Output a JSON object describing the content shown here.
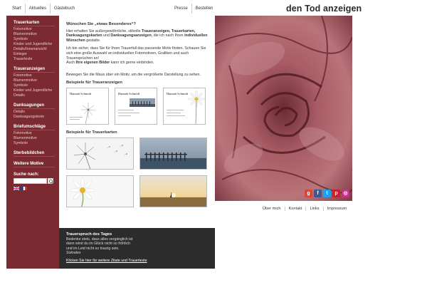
{
  "nav_left": [
    "Start",
    "Aktuelles",
    "Gästebuch"
  ],
  "nav_right": [
    "Presse",
    "Bestellen"
  ],
  "site_title": "den Tod anzeigen",
  "sidebar": {
    "groups": [
      {
        "title": "Trauerkarten",
        "items": [
          "Fotomotive",
          "Blumenmotive",
          "Symbole",
          "Kinder und Jugendliche",
          "Details/Innenansicht",
          "Einleger",
          "Trauertexte"
        ]
      },
      {
        "title": "Traueranzeigen",
        "items": [
          "Fotomotive",
          "Blumenmotive",
          "Symbole",
          "Kinder und Jugendliche",
          "Details"
        ]
      },
      {
        "title": "Danksagungen",
        "items": [
          "Details",
          "Danksagungstexte"
        ]
      },
      {
        "title": "Briefumschläge",
        "items": [
          "Fotomotive",
          "Blumenmotive",
          "Symbole"
        ]
      },
      {
        "title": "Sterbebildchen",
        "items": []
      },
      {
        "title": "Weitere Motive",
        "items": []
      }
    ],
    "search_label": "Suche nach:",
    "search_placeholder": ""
  },
  "main": {
    "heading": "Wünschen Sie „etwas Besonderes“?",
    "p1_a": "Hier erhalten Sie außergewöhnliche, stilvolle ",
    "p1_b": "Traueranzeigen, Trauerkarten, Danksagungskarten",
    "p1_c": " und ",
    "p1_d": "Danksagungsanzeigen",
    "p1_e": ", die ich nach Ihren ",
    "p1_f": "individuellen Wünschen",
    "p1_g": " gestalte.",
    "p2_a": "Ich bin sicher, dass Sie für Ihren Trauerfall das passende Motiv finden. Schauen Sie sich eine große Auswahl an individuellen Fotomotiven, Grafiken und auch Trauersprüchen an!",
    "p2_b": "Auch ",
    "p2_c": "Ihre eigenen Bilder",
    "p2_d": " kann ich gerne einbinden.",
    "hover_hint": "Bewegen Sie die Maus über ein Motiv, um die vergrößerte Darstellung zu sehen.",
    "section1": "Beispiele für Traueranzeigen",
    "section2": "Beispiele für Trauerkarten",
    "sample_name": "Hannah Schmidt"
  },
  "quote": {
    "title": "Trauerspruch des Tages",
    "lines": [
      "Bedenke stets, dass alles vergänglich ist",
      "dann wirst du im Glück nicht so fröhlich",
      "und im Leid nicht so traurig sein."
    ],
    "author": "Sokrates",
    "link": "Klicken Sie hier für weitere Zitate und Trauertexte"
  },
  "footer_links": [
    "Über mich",
    "Kontakt",
    "Links",
    "Impressum"
  ],
  "social": [
    {
      "icon": "google-plus-icon",
      "glyph": "g",
      "color": "#d34836"
    },
    {
      "icon": "facebook-icon",
      "glyph": "f",
      "color": "#3b5998"
    },
    {
      "icon": "twitter-icon",
      "glyph": "t",
      "color": "#1da1f2"
    },
    {
      "icon": "pinterest-icon",
      "glyph": "p",
      "color": "#cb2027"
    },
    {
      "icon": "instagram-icon",
      "glyph": "◎",
      "color": "#c13584"
    }
  ],
  "colors": {
    "sidebar": "#7a2a30",
    "panel": "#2c2c2c",
    "rose": "#8e4850"
  }
}
